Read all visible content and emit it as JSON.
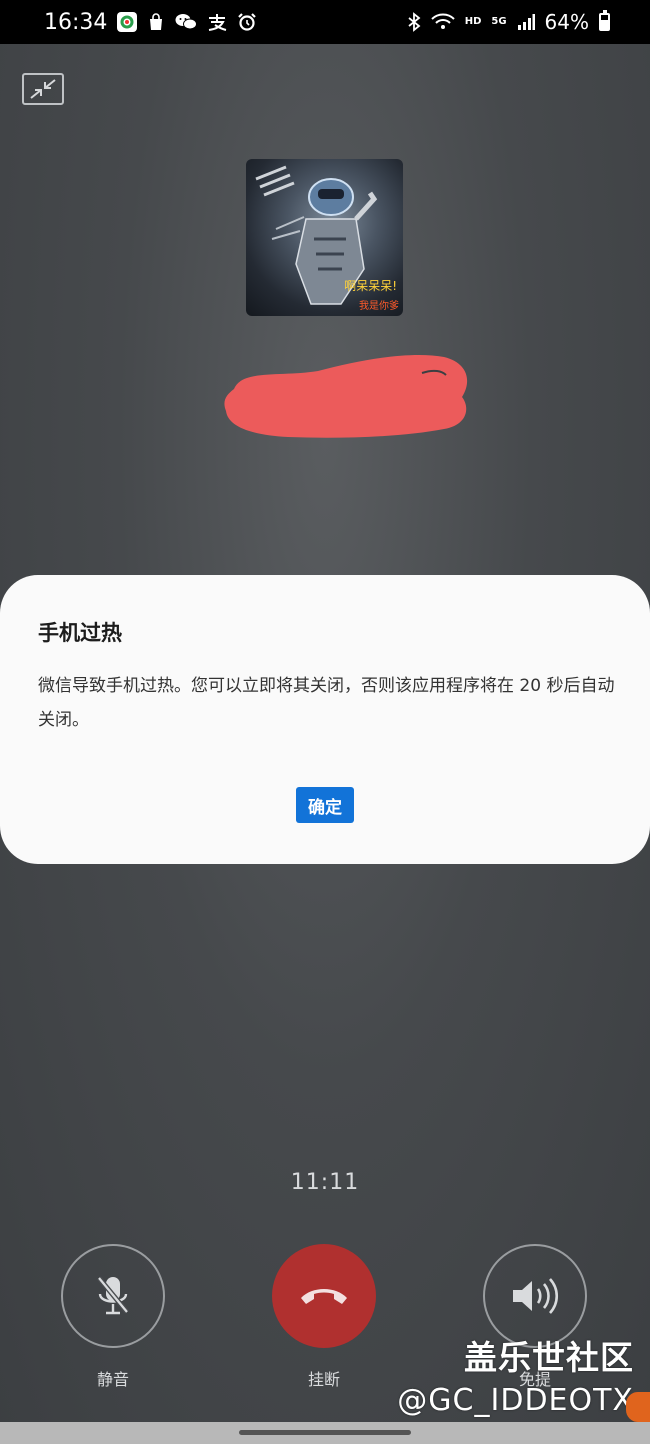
{
  "status_bar": {
    "time": "16:34",
    "battery_percent": "64%",
    "network_hd": "HD",
    "network_5g": "5G",
    "left_icons": [
      "app-store-icon",
      "shopping-bag-icon",
      "wechat-icon",
      "alipay-icon",
      "alarm-icon"
    ],
    "right_icons": [
      "bluetooth-icon",
      "wifi-icon",
      "signal-icon",
      "battery-icon"
    ]
  },
  "call": {
    "timer": "11:11",
    "controls": {
      "mute_label": "静音",
      "hangup_label": "挂断",
      "speaker_label": "免提"
    }
  },
  "avatar": {
    "overlay_text_1": "啊呆呆呆!",
    "overlay_text_2": "我是你爹"
  },
  "dialog": {
    "title": "手机过热",
    "message": "微信导致手机过热。您可以立即将其关闭，否则该应用程序将在 20 秒后自动关闭。",
    "ok_label": "确定"
  },
  "watermark": {
    "line1": "盖乐世社区",
    "line2": "@GC_IDDEOTX"
  },
  "colors": {
    "dialog_button": "#1273d8",
    "hangup": "#b0302f",
    "redaction": "#ec5b5b",
    "dialog_bg": "#fafafa"
  }
}
